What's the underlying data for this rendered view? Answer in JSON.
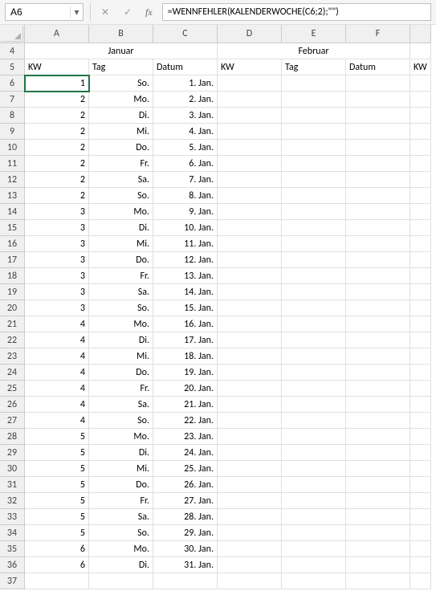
{
  "namebox": {
    "value": "A6"
  },
  "formula": "=WENNFEHLER(KALENDERWOCHE(C6;2);\"\")",
  "columns": [
    "A",
    "B",
    "C",
    "D",
    "E",
    "F"
  ],
  "months": {
    "januar": "Januar",
    "februar": "Februar"
  },
  "headers": {
    "kw": "KW",
    "tag": "Tag",
    "datum": "Datum"
  },
  "activeCell": "A6",
  "rows": [
    {
      "r": 6,
      "kw": "1",
      "tag": "So.",
      "datum": "1. Jan."
    },
    {
      "r": 7,
      "kw": "2",
      "tag": "Mo.",
      "datum": "2. Jan."
    },
    {
      "r": 8,
      "kw": "2",
      "tag": "Di.",
      "datum": "3. Jan."
    },
    {
      "r": 9,
      "kw": "2",
      "tag": "Mi.",
      "datum": "4. Jan."
    },
    {
      "r": 10,
      "kw": "2",
      "tag": "Do.",
      "datum": "5. Jan."
    },
    {
      "r": 11,
      "kw": "2",
      "tag": "Fr.",
      "datum": "6. Jan."
    },
    {
      "r": 12,
      "kw": "2",
      "tag": "Sa.",
      "datum": "7. Jan."
    },
    {
      "r": 13,
      "kw": "2",
      "tag": "So.",
      "datum": "8. Jan."
    },
    {
      "r": 14,
      "kw": "3",
      "tag": "Mo.",
      "datum": "9. Jan."
    },
    {
      "r": 15,
      "kw": "3",
      "tag": "Di.",
      "datum": "10. Jan."
    },
    {
      "r": 16,
      "kw": "3",
      "tag": "Mi.",
      "datum": "11. Jan."
    },
    {
      "r": 17,
      "kw": "3",
      "tag": "Do.",
      "datum": "12. Jan."
    },
    {
      "r": 18,
      "kw": "3",
      "tag": "Fr.",
      "datum": "13. Jan."
    },
    {
      "r": 19,
      "kw": "3",
      "tag": "Sa.",
      "datum": "14. Jan."
    },
    {
      "r": 20,
      "kw": "3",
      "tag": "So.",
      "datum": "15. Jan."
    },
    {
      "r": 21,
      "kw": "4",
      "tag": "Mo.",
      "datum": "16. Jan."
    },
    {
      "r": 22,
      "kw": "4",
      "tag": "Di.",
      "datum": "17. Jan."
    },
    {
      "r": 23,
      "kw": "4",
      "tag": "Mi.",
      "datum": "18. Jan."
    },
    {
      "r": 24,
      "kw": "4",
      "tag": "Do.",
      "datum": "19. Jan."
    },
    {
      "r": 25,
      "kw": "4",
      "tag": "Fr.",
      "datum": "20. Jan."
    },
    {
      "r": 26,
      "kw": "4",
      "tag": "Sa.",
      "datum": "21. Jan."
    },
    {
      "r": 27,
      "kw": "4",
      "tag": "So.",
      "datum": "22. Jan."
    },
    {
      "r": 28,
      "kw": "5",
      "tag": "Mo.",
      "datum": "23. Jan."
    },
    {
      "r": 29,
      "kw": "5",
      "tag": "Di.",
      "datum": "24. Jan."
    },
    {
      "r": 30,
      "kw": "5",
      "tag": "Mi.",
      "datum": "25. Jan."
    },
    {
      "r": 31,
      "kw": "5",
      "tag": "Do.",
      "datum": "26. Jan."
    },
    {
      "r": 32,
      "kw": "5",
      "tag": "Fr.",
      "datum": "27. Jan."
    },
    {
      "r": 33,
      "kw": "5",
      "tag": "Sa.",
      "datum": "28. Jan."
    },
    {
      "r": 34,
      "kw": "5",
      "tag": "So.",
      "datum": "29. Jan."
    },
    {
      "r": 35,
      "kw": "6",
      "tag": "Mo.",
      "datum": "30. Jan."
    },
    {
      "r": 36,
      "kw": "6",
      "tag": "Di.",
      "datum": "31. Jan."
    },
    {
      "r": 37,
      "kw": "",
      "tag": "",
      "datum": ""
    }
  ]
}
